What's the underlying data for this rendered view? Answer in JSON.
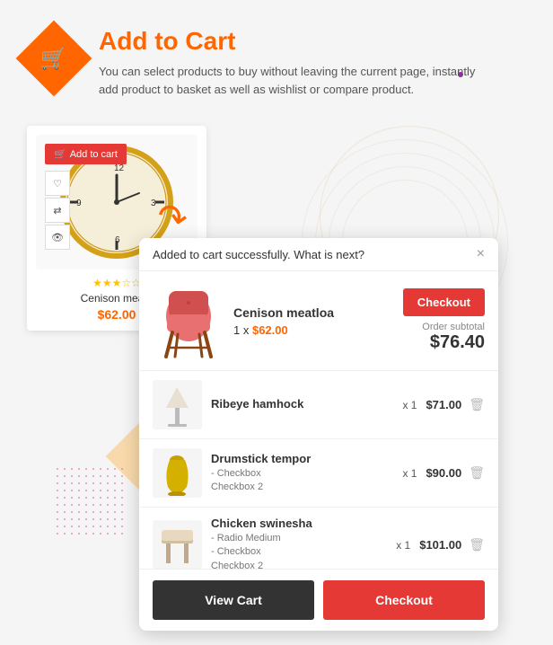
{
  "header": {
    "icon_label": "🛒",
    "title": "Add to Cart",
    "description": "You can select products to buy without leaving the current page, instantly add product to basket as well as wishlist or compare product."
  },
  "product": {
    "name": "Cenison mea...",
    "price": "$62.00",
    "add_to_cart_label": "Add to cart",
    "wishlist_icon": "♡",
    "compare_icon": "⇄",
    "view_icon": "👁"
  },
  "popup": {
    "header_text": "Added to cart successfully. What is next?",
    "close_icon": "×",
    "main_item": {
      "name": "Cenison meatloa",
      "qty": "1",
      "price": "$62.00",
      "checkout_label": "Checkout"
    },
    "subtotal": {
      "label": "Order subtotal",
      "value": "$76.40"
    },
    "items": [
      {
        "name": "Ribeye hamhock",
        "qty": "x 1",
        "price": "$71.00",
        "variant": ""
      },
      {
        "name": "Drumstick tempor",
        "variant": "- Checkbox\n Checkbox 2",
        "qty": "x 1",
        "price": "$90.00"
      },
      {
        "name": "Chicken swinesha",
        "variant": "- Radio Medium\n- Checkbox\n Checkbox 2",
        "qty": "x 1",
        "price": "$101.00"
      }
    ],
    "view_cart_label": "View Cart",
    "checkout_label": "Checkout"
  }
}
